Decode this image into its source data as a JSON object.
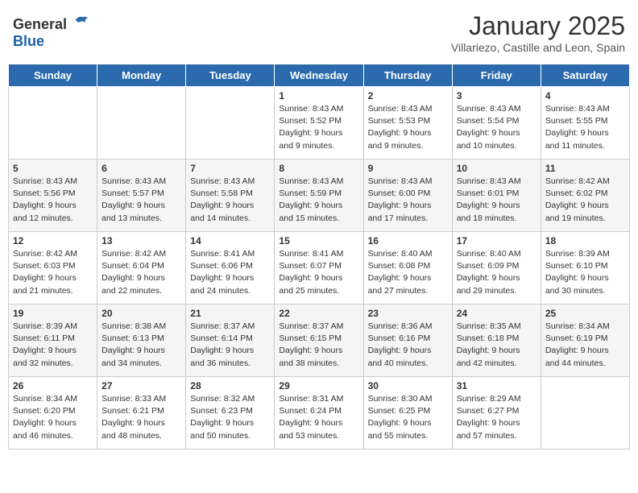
{
  "header": {
    "logo_general": "General",
    "logo_blue": "Blue",
    "title": "January 2025",
    "location": "Villariezo, Castille and Leon, Spain"
  },
  "weekdays": [
    "Sunday",
    "Monday",
    "Tuesday",
    "Wednesday",
    "Thursday",
    "Friday",
    "Saturday"
  ],
  "rows": [
    {
      "cells": [
        {
          "day": "",
          "empty": true
        },
        {
          "day": "",
          "empty": true
        },
        {
          "day": "",
          "empty": true
        },
        {
          "day": "1",
          "sunrise": "8:43 AM",
          "sunset": "5:52 PM",
          "daylight": "9 hours and 9 minutes."
        },
        {
          "day": "2",
          "sunrise": "8:43 AM",
          "sunset": "5:53 PM",
          "daylight": "9 hours and 9 minutes."
        },
        {
          "day": "3",
          "sunrise": "8:43 AM",
          "sunset": "5:54 PM",
          "daylight": "9 hours and 10 minutes."
        },
        {
          "day": "4",
          "sunrise": "8:43 AM",
          "sunset": "5:55 PM",
          "daylight": "9 hours and 11 minutes."
        }
      ]
    },
    {
      "cells": [
        {
          "day": "5",
          "sunrise": "8:43 AM",
          "sunset": "5:56 PM",
          "daylight": "9 hours and 12 minutes."
        },
        {
          "day": "6",
          "sunrise": "8:43 AM",
          "sunset": "5:57 PM",
          "daylight": "9 hours and 13 minutes."
        },
        {
          "day": "7",
          "sunrise": "8:43 AM",
          "sunset": "5:58 PM",
          "daylight": "9 hours and 14 minutes."
        },
        {
          "day": "8",
          "sunrise": "8:43 AM",
          "sunset": "5:59 PM",
          "daylight": "9 hours and 15 minutes."
        },
        {
          "day": "9",
          "sunrise": "8:43 AM",
          "sunset": "6:00 PM",
          "daylight": "9 hours and 17 minutes."
        },
        {
          "day": "10",
          "sunrise": "8:43 AM",
          "sunset": "6:01 PM",
          "daylight": "9 hours and 18 minutes."
        },
        {
          "day": "11",
          "sunrise": "8:42 AM",
          "sunset": "6:02 PM",
          "daylight": "9 hours and 19 minutes."
        }
      ]
    },
    {
      "cells": [
        {
          "day": "12",
          "sunrise": "8:42 AM",
          "sunset": "6:03 PM",
          "daylight": "9 hours and 21 minutes."
        },
        {
          "day": "13",
          "sunrise": "8:42 AM",
          "sunset": "6:04 PM",
          "daylight": "9 hours and 22 minutes."
        },
        {
          "day": "14",
          "sunrise": "8:41 AM",
          "sunset": "6:06 PM",
          "daylight": "9 hours and 24 minutes."
        },
        {
          "day": "15",
          "sunrise": "8:41 AM",
          "sunset": "6:07 PM",
          "daylight": "9 hours and 25 minutes."
        },
        {
          "day": "16",
          "sunrise": "8:40 AM",
          "sunset": "6:08 PM",
          "daylight": "9 hours and 27 minutes."
        },
        {
          "day": "17",
          "sunrise": "8:40 AM",
          "sunset": "6:09 PM",
          "daylight": "9 hours and 29 minutes."
        },
        {
          "day": "18",
          "sunrise": "8:39 AM",
          "sunset": "6:10 PM",
          "daylight": "9 hours and 30 minutes."
        }
      ]
    },
    {
      "cells": [
        {
          "day": "19",
          "sunrise": "8:39 AM",
          "sunset": "6:11 PM",
          "daylight": "9 hours and 32 minutes."
        },
        {
          "day": "20",
          "sunrise": "8:38 AM",
          "sunset": "6:13 PM",
          "daylight": "9 hours and 34 minutes."
        },
        {
          "day": "21",
          "sunrise": "8:37 AM",
          "sunset": "6:14 PM",
          "daylight": "9 hours and 36 minutes."
        },
        {
          "day": "22",
          "sunrise": "8:37 AM",
          "sunset": "6:15 PM",
          "daylight": "9 hours and 38 minutes."
        },
        {
          "day": "23",
          "sunrise": "8:36 AM",
          "sunset": "6:16 PM",
          "daylight": "9 hours and 40 minutes."
        },
        {
          "day": "24",
          "sunrise": "8:35 AM",
          "sunset": "6:18 PM",
          "daylight": "9 hours and 42 minutes."
        },
        {
          "day": "25",
          "sunrise": "8:34 AM",
          "sunset": "6:19 PM",
          "daylight": "9 hours and 44 minutes."
        }
      ]
    },
    {
      "cells": [
        {
          "day": "26",
          "sunrise": "8:34 AM",
          "sunset": "6:20 PM",
          "daylight": "9 hours and 46 minutes."
        },
        {
          "day": "27",
          "sunrise": "8:33 AM",
          "sunset": "6:21 PM",
          "daylight": "9 hours and 48 minutes."
        },
        {
          "day": "28",
          "sunrise": "8:32 AM",
          "sunset": "6:23 PM",
          "daylight": "9 hours and 50 minutes."
        },
        {
          "day": "29",
          "sunrise": "8:31 AM",
          "sunset": "6:24 PM",
          "daylight": "9 hours and 53 minutes."
        },
        {
          "day": "30",
          "sunrise": "8:30 AM",
          "sunset": "6:25 PM",
          "daylight": "9 hours and 55 minutes."
        },
        {
          "day": "31",
          "sunrise": "8:29 AM",
          "sunset": "6:27 PM",
          "daylight": "9 hours and 57 minutes."
        },
        {
          "day": "",
          "empty": true
        }
      ]
    }
  ]
}
